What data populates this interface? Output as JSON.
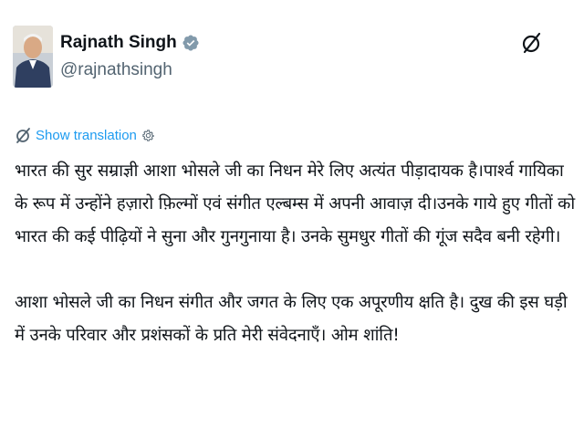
{
  "author": {
    "display_name": "Rajnath Singh",
    "handle": "@rajnathsingh",
    "verified_color": "#1d9bf0"
  },
  "translate": {
    "label": "Show translation",
    "icon": "translate-icon",
    "settings_icon": "gear-icon"
  },
  "header_icon": "grok-icon",
  "tweet": {
    "paragraphs": [
      "भारत की सुर सम्राज्ञी आशा भोसले जी का निधन मेरे लिए अत्यंत पीड़ादायक है।पार्श्व गायिका के रूप में उन्होंने हज़ारो फ़िल्मों एवं संगीत एल्बम्स में अपनी आवाज़ दी।उनके गाये हुए गीतों को भारत की कई पीढ़ियों ने सुना और गुनगुनाया है। उनके सुमधुर गीतों की गूंज सदैव बनी रहेगी।",
      "आशा भोसले जी का निधन संगीत और जगत के लिए एक अपूरणीय क्षति है। दुख की इस घड़ी में उनके परिवार और प्रशंसकों के प्रति मेरी संवेदनाएँ। ओम शांति!"
    ]
  },
  "colors": {
    "link": "#1d9bf0",
    "text": "#0f1419",
    "muted": "#536471"
  }
}
